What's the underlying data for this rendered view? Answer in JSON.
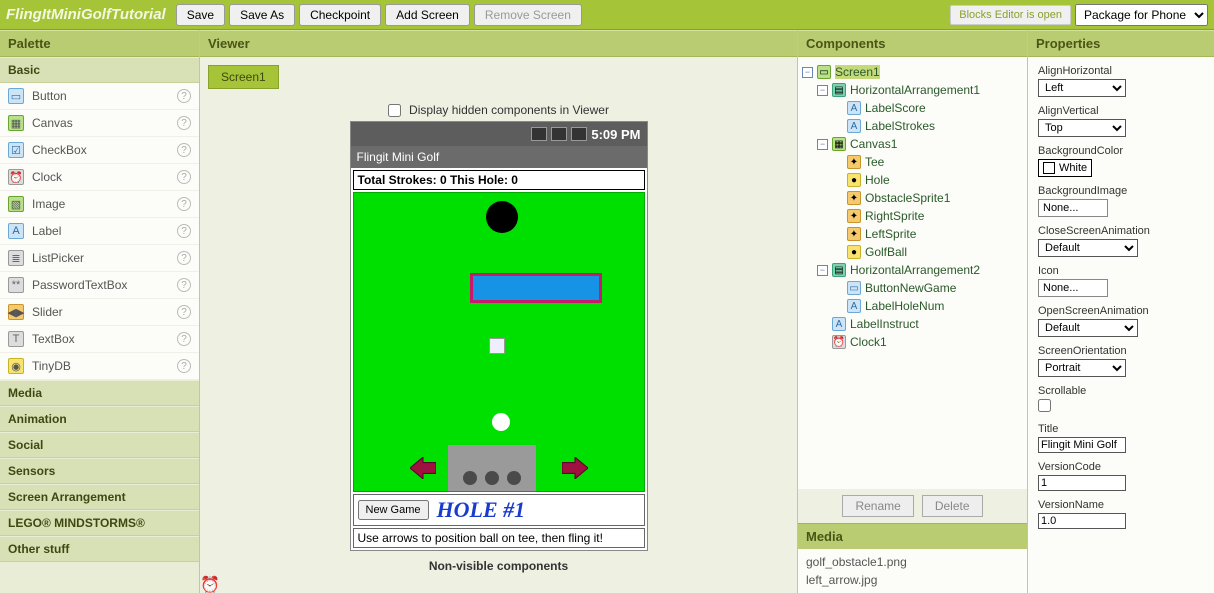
{
  "project_title": "FlingItMiniGolfTutorial",
  "topbar": {
    "save": "Save",
    "save_as": "Save As",
    "checkpoint": "Checkpoint",
    "add_screen": "Add Screen",
    "remove_screen": "Remove Screen",
    "blocks_status": "Blocks Editor is open",
    "package_label": "Package for Phone"
  },
  "panels": {
    "palette": "Palette",
    "viewer": "Viewer",
    "components": "Components",
    "properties": "Properties",
    "media": "Media"
  },
  "palette": {
    "basic": "Basic",
    "items": [
      {
        "label": "Button"
      },
      {
        "label": "Canvas"
      },
      {
        "label": "CheckBox"
      },
      {
        "label": "Clock"
      },
      {
        "label": "Image"
      },
      {
        "label": "Label"
      },
      {
        "label": "ListPicker"
      },
      {
        "label": "PasswordTextBox"
      },
      {
        "label": "Slider"
      },
      {
        "label": "TextBox"
      },
      {
        "label": "TinyDB"
      }
    ],
    "categories": [
      "Media",
      "Animation",
      "Social",
      "Sensors",
      "Screen Arrangement",
      "LEGO® MINDSTORMS®",
      "Other stuff"
    ]
  },
  "viewer": {
    "screen_tab": "Screen1",
    "display_hidden": "Display hidden components in Viewer",
    "status_time": "5:09 PM",
    "app_title": "Flingit Mini Golf",
    "score_text": "Total Strokes: 0   This Hole: 0",
    "new_game": "New Game",
    "hole_num": "HOLE #1",
    "instruct": "Use arrows to position ball on tee, then fling it!",
    "nonvisible": "Non-visible components"
  },
  "components": {
    "tree": [
      {
        "level": 0,
        "toggle": "-",
        "label": "Screen1",
        "icon": "screen",
        "selected": true
      },
      {
        "level": 1,
        "toggle": "-",
        "label": "HorizontalArrangement1",
        "icon": "harr"
      },
      {
        "level": 2,
        "toggle": "",
        "label": "LabelScore",
        "icon": "label"
      },
      {
        "level": 2,
        "toggle": "",
        "label": "LabelStrokes",
        "icon": "label"
      },
      {
        "level": 1,
        "toggle": "-",
        "label": "Canvas1",
        "icon": "canvas"
      },
      {
        "level": 2,
        "toggle": "",
        "label": "Tee",
        "icon": "sprite"
      },
      {
        "level": 2,
        "toggle": "",
        "label": "Hole",
        "icon": "ball"
      },
      {
        "level": 2,
        "toggle": "",
        "label": "ObstacleSprite1",
        "icon": "sprite"
      },
      {
        "level": 2,
        "toggle": "",
        "label": "RightSprite",
        "icon": "sprite"
      },
      {
        "level": 2,
        "toggle": "",
        "label": "LeftSprite",
        "icon": "sprite"
      },
      {
        "level": 2,
        "toggle": "",
        "label": "GolfBall",
        "icon": "ball"
      },
      {
        "level": 1,
        "toggle": "-",
        "label": "HorizontalArrangement2",
        "icon": "harr"
      },
      {
        "level": 2,
        "toggle": "",
        "label": "ButtonNewGame",
        "icon": "button"
      },
      {
        "level": 2,
        "toggle": "",
        "label": "LabelHoleNum",
        "icon": "label"
      },
      {
        "level": 1,
        "toggle": "",
        "label": "LabelInstruct",
        "icon": "label"
      },
      {
        "level": 1,
        "toggle": "",
        "label": "Clock1",
        "icon": "clock"
      }
    ],
    "rename": "Rename",
    "delete": "Delete",
    "media_files": [
      "golf_obstacle1.png",
      "left_arrow.jpg"
    ]
  },
  "properties": {
    "AlignHorizontal": {
      "label": "AlignHorizontal",
      "value": "Left"
    },
    "AlignVertical": {
      "label": "AlignVertical",
      "value": "Top"
    },
    "BackgroundColor": {
      "label": "BackgroundColor",
      "value": "White"
    },
    "BackgroundImage": {
      "label": "BackgroundImage",
      "value": "None..."
    },
    "CloseScreenAnimation": {
      "label": "CloseScreenAnimation",
      "value": "Default"
    },
    "Icon": {
      "label": "Icon",
      "value": "None..."
    },
    "OpenScreenAnimation": {
      "label": "OpenScreenAnimation",
      "value": "Default"
    },
    "ScreenOrientation": {
      "label": "ScreenOrientation",
      "value": "Portrait"
    },
    "Scrollable": {
      "label": "Scrollable",
      "checked": false
    },
    "Title": {
      "label": "Title",
      "value": "Flingit Mini Golf"
    },
    "VersionCode": {
      "label": "VersionCode",
      "value": "1"
    },
    "VersionName": {
      "label": "VersionName",
      "value": "1.0"
    }
  }
}
